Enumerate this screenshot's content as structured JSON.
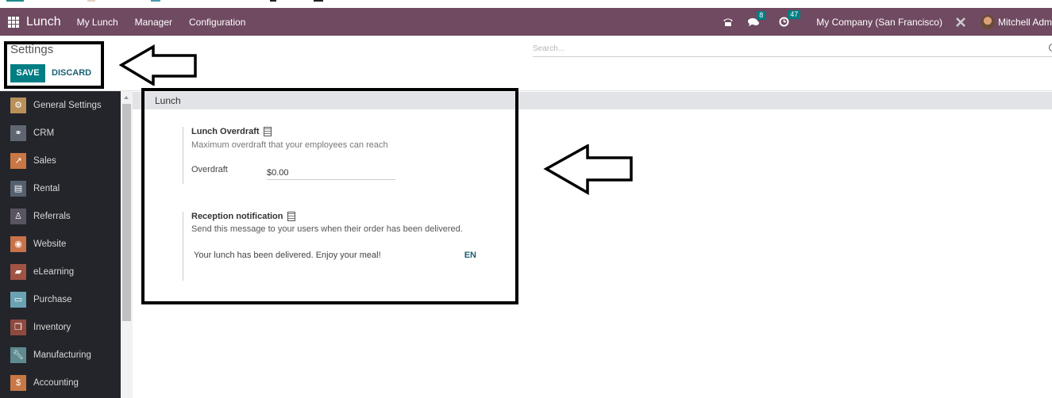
{
  "navbar": {
    "app_name": "Lunch",
    "menus": [
      "My Lunch",
      "Manager",
      "Configuration"
    ],
    "phone_icon": "phone-icon",
    "messages_icon": "chat-icon",
    "messages_count": "8",
    "activities_icon": "clock-icon",
    "activities_count": "47",
    "company": "My Company (San Francisco)",
    "debug_icon": "tools-icon",
    "user_name": "Mitchell Adm",
    "brand_color": "#6f4a60"
  },
  "control_panel": {
    "breadcrumb": "Settings",
    "save_label": "SAVE",
    "discard_label": "DISCARD",
    "search_placeholder": "Search..."
  },
  "sidebar": {
    "items": [
      {
        "label": "General Settings",
        "icon": "gear-icon",
        "color": "#b8905a"
      },
      {
        "label": "CRM",
        "icon": "handshake-icon",
        "color": "#5f6672"
      },
      {
        "label": "Sales",
        "icon": "chart-icon",
        "color": "#c87845"
      },
      {
        "label": "Rental",
        "icon": "rental-icon",
        "color": "#55606e"
      },
      {
        "label": "Referrals",
        "icon": "referrals-icon",
        "color": "#585560"
      },
      {
        "label": "Website",
        "icon": "globe-icon",
        "color": "#c8724a"
      },
      {
        "label": "eLearning",
        "icon": "elearning-icon",
        "color": "#a05444"
      },
      {
        "label": "Purchase",
        "icon": "credit-card-icon",
        "color": "#6aa2b4"
      },
      {
        "label": "Inventory",
        "icon": "box-icon",
        "color": "#8e4a3e"
      },
      {
        "label": "Manufacturing",
        "icon": "wrench-icon",
        "color": "#5e8a90"
      },
      {
        "label": "Accounting",
        "icon": "invoice-icon",
        "color": "#c87845"
      }
    ]
  },
  "content": {
    "section_title": "Lunch",
    "overdraft": {
      "title": "Lunch Overdraft",
      "description": "Maximum overdraft that your employees can reach",
      "field_label": "Overdraft",
      "value": "$0.00"
    },
    "notification": {
      "title": "Reception notification",
      "description": "Send this message to your users when their order has been delivered.",
      "message": "Your lunch has been delivered. Enjoy your meal!",
      "lang": "EN"
    }
  }
}
